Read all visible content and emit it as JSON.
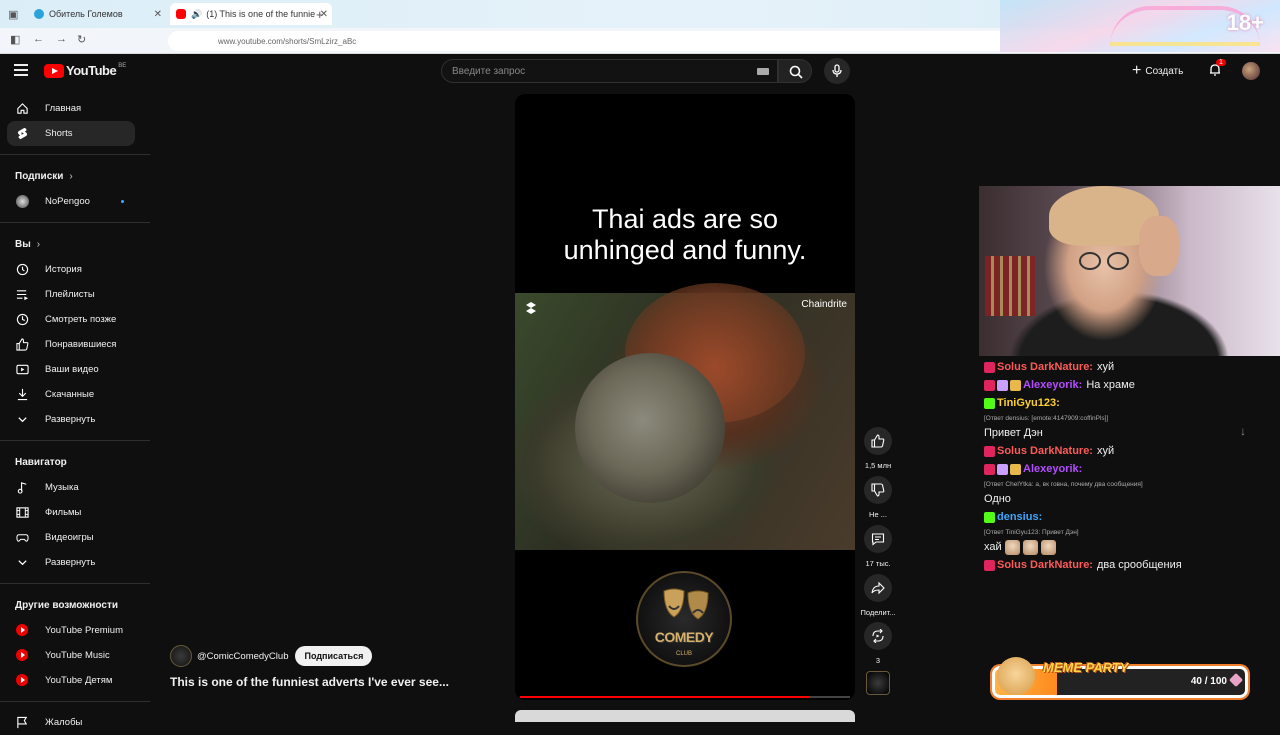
{
  "browser": {
    "tabs": [
      {
        "title": "Обитель Големов",
        "fav_color": "#2aa3dd"
      },
      {
        "title": "(1) This is one of the funnie",
        "fav_color": "#ff0000"
      }
    ],
    "url": "www.youtube.com/shorts/SmLzirz_aBc"
  },
  "header": {
    "logo_text": "YouTube",
    "region": "BE",
    "search_placeholder": "Введите запрос",
    "create_label": "Создать",
    "notifications_count": "1"
  },
  "sidebar": {
    "main": [
      {
        "label": "Главная",
        "icon": "home-icon"
      },
      {
        "label": "Shorts",
        "icon": "shorts-icon"
      }
    ],
    "subscriptions_title": "Подписки",
    "subscriptions": [
      {
        "label": "NoPengoo",
        "icon": "channel-avatar"
      }
    ],
    "you_title": "Вы",
    "you": [
      {
        "label": "История",
        "icon": "history-icon"
      },
      {
        "label": "Плейлисты",
        "icon": "playlist-icon"
      },
      {
        "label": "Смотреть позже",
        "icon": "clock-icon"
      },
      {
        "label": "Понравившиеся",
        "icon": "like-icon"
      },
      {
        "label": "Ваши видео",
        "icon": "video-icon"
      },
      {
        "label": "Скачанные",
        "icon": "download-icon"
      },
      {
        "label": "Развернуть",
        "icon": "chevron-down-icon"
      }
    ],
    "explore_title": "Навигатор",
    "explore": [
      {
        "label": "Музыка",
        "icon": "music-icon"
      },
      {
        "label": "Фильмы",
        "icon": "film-icon"
      },
      {
        "label": "Видеоигры",
        "icon": "gamepad-icon"
      },
      {
        "label": "Развернуть",
        "icon": "chevron-down-icon"
      }
    ],
    "more_title": "Другие возможности",
    "more": [
      {
        "label": "YouTube Premium"
      },
      {
        "label": "YouTube Music"
      },
      {
        "label": "YouTube Детям"
      }
    ],
    "report": {
      "label": "Жалобы",
      "icon": "flag-icon"
    }
  },
  "short": {
    "caption_line1": "Thai ads are so",
    "caption_line2": "unhinged and funny.",
    "watermark": "Chaindrite",
    "logo_text": "COMEDY",
    "logo_subtext": "CLUB",
    "progress": 0.88,
    "channel_handle": "@ComicComedyClub",
    "subscribe_label": "Подписаться",
    "title": "This is one of the funniest adverts I've ever see..."
  },
  "actions": {
    "like_count": "1,5 млн",
    "dislike_label": "Не ...",
    "comments_count": "17 тыс.",
    "share_label": "Поделит...",
    "remix_count": "3"
  },
  "stream_chat": [
    {
      "name": "Solus DarkNature:",
      "color": "#ff5a5a",
      "text": "хуй",
      "badges": [
        "live"
      ]
    },
    {
      "name": "Alexeyorik:",
      "color": "#b44cff",
      "text": "На храме",
      "badges": [
        "live",
        "sub",
        "gift"
      ]
    },
    {
      "name": "TiniGyu123:",
      "color": "#ffd02a",
      "text": "",
      "badges": [
        "kick"
      ]
    },
    {
      "reply": "[Ответ densius: [emote:4147909:coffinPls]]"
    },
    {
      "name": "",
      "color": "#ffffff",
      "text": "Привет Дэн",
      "badges": []
    },
    {
      "name": "Solus DarkNature:",
      "color": "#ff5a5a",
      "text": "хуй",
      "badges": [
        "live"
      ]
    },
    {
      "name": "Alexeyorik:",
      "color": "#b44cff",
      "text": "",
      "badges": [
        "live",
        "sub",
        "gift"
      ]
    },
    {
      "reply": "[Ответ ChelYtka: а, вк говна, почему два сообщения]"
    },
    {
      "name": "",
      "color": "#ffffff",
      "text": "Одно",
      "badges": []
    },
    {
      "name": "densius:",
      "color": "#3ea6ff",
      "text": "",
      "badges": [
        "kick"
      ]
    },
    {
      "reply": "[Ответ TiniGyu123: Привет Дэн]"
    },
    {
      "name": "",
      "color": "#ffffff",
      "text": "хай",
      "badges": [],
      "emotes": 3
    },
    {
      "name": "Solus DarkNature:",
      "color": "#ff5a5a",
      "text": "два срообщения",
      "badges": [
        "live"
      ]
    }
  ],
  "goal": {
    "title": "MEME PARTY",
    "value_text": "40 / 100",
    "progress": 0.4
  }
}
